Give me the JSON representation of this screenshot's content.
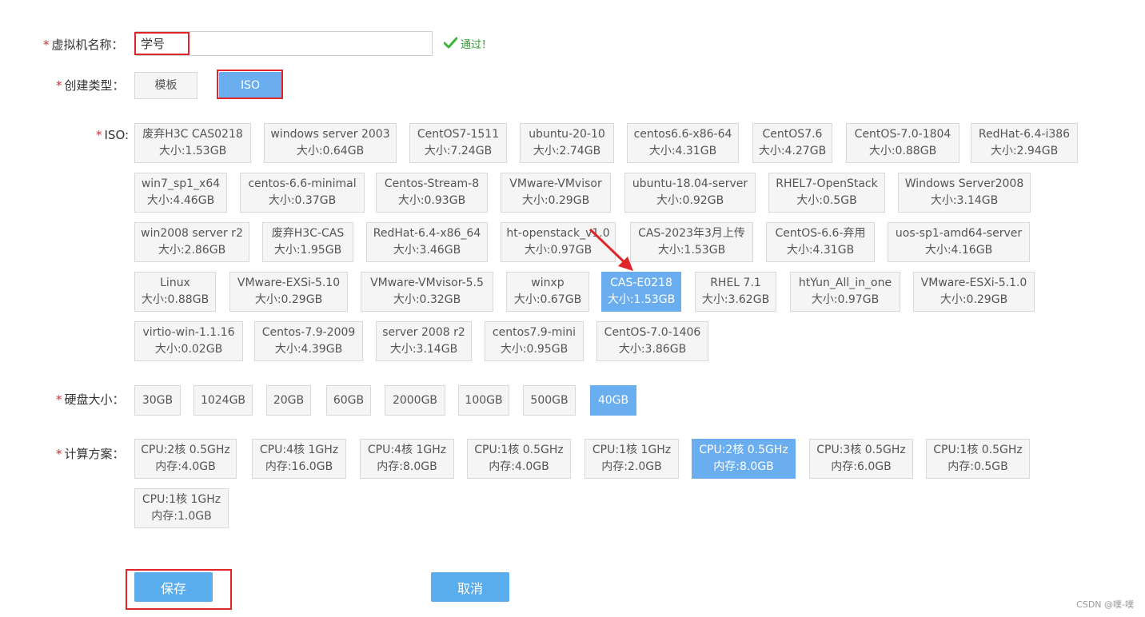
{
  "form": {
    "vm_name": {
      "label": "虚拟机名称：",
      "value": "学号",
      "status": "通过！"
    },
    "create_type": {
      "label": "创建类型：",
      "options": [
        "模板",
        "ISO"
      ],
      "selected": "ISO"
    },
    "iso": {
      "label": "ISO:",
      "items": [
        {
          "name": "废弃H3C CAS0218",
          "size": "大小:1.53GB"
        },
        {
          "name": "windows server 2003",
          "size": "大小:0.64GB"
        },
        {
          "name": "CentOS7-1511",
          "size": "大小:7.24GB"
        },
        {
          "name": "ubuntu-20-10",
          "size": "大小:2.74GB"
        },
        {
          "name": "centos6.6-x86-64",
          "size": "大小:4.31GB"
        },
        {
          "name": "CentOS7.6",
          "size": "大小:4.27GB"
        },
        {
          "name": "CentOS-7.0-1804",
          "size": "大小:0.88GB"
        },
        {
          "name": "RedHat-6.4-i386",
          "size": "大小:2.94GB"
        },
        {
          "name": "win7_sp1_x64",
          "size": "大小:4.46GB"
        },
        {
          "name": "centos-6.6-minimal",
          "size": "大小:0.37GB"
        },
        {
          "name": "Centos-Stream-8",
          "size": "大小:0.93GB"
        },
        {
          "name": "VMware-VMvisor",
          "size": "大小:0.29GB"
        },
        {
          "name": "ubuntu-18.04-server",
          "size": "大小:0.92GB"
        },
        {
          "name": "RHEL7-OpenStack",
          "size": "大小:0.5GB"
        },
        {
          "name": "Windows Server2008",
          "size": "大小:3.14GB"
        },
        {
          "name": "win2008 server r2",
          "size": "大小:2.86GB"
        },
        {
          "name": "废弃H3C-CAS",
          "size": "大小:1.95GB"
        },
        {
          "name": "RedHat-6.4-x86_64",
          "size": "大小:3.46GB"
        },
        {
          "name": "ht-openstack_v1.0",
          "size": "大小:0.97GB"
        },
        {
          "name": "CAS-2023年3月上传",
          "size": "大小:1.53GB"
        },
        {
          "name": "CentOS-6.6-弃用",
          "size": "大小:4.31GB"
        },
        {
          "name": "uos-sp1-amd64-server",
          "size": "大小:4.16GB"
        },
        {
          "name": "Linux",
          "size": "大小:0.88GB"
        },
        {
          "name": "VMware-EXSi-5.10",
          "size": "大小:0.29GB"
        },
        {
          "name": "VMware-VMvisor-5.5",
          "size": "大小:0.32GB"
        },
        {
          "name": "winxp",
          "size": "大小:0.67GB"
        },
        {
          "name": "CAS-E0218",
          "size": "大小:1.53GB"
        },
        {
          "name": "RHEL 7.1",
          "size": "大小:3.62GB"
        },
        {
          "name": "htYun_All_in_one",
          "size": "大小:0.97GB"
        },
        {
          "name": "VMware-ESXi-5.1.0",
          "size": "大小:0.29GB"
        },
        {
          "name": "virtio-win-1.1.16",
          "size": "大小:0.02GB"
        },
        {
          "name": "Centos-7.9-2009",
          "size": "大小:4.39GB"
        },
        {
          "name": "server 2008 r2",
          "size": "大小:3.14GB"
        },
        {
          "name": "centos7.9-mini",
          "size": "大小:0.95GB"
        },
        {
          "name": "CentOS-7.0-1406",
          "size": "大小:3.86GB"
        }
      ],
      "selected": "CAS-E0218"
    },
    "disk": {
      "label": "硬盘大小：",
      "options": [
        "30GB",
        "1024GB",
        "20GB",
        "60GB",
        "2000GB",
        "100GB",
        "500GB",
        "40GB"
      ],
      "selected": "40GB"
    },
    "compute": {
      "label": "计算方案：",
      "options": [
        {
          "cpu": "CPU:2核 0.5GHz",
          "mem": "内存:4.0GB"
        },
        {
          "cpu": "CPU:4核 1GHz",
          "mem": "内存:16.0GB"
        },
        {
          "cpu": "CPU:4核 1GHz",
          "mem": "内存:8.0GB"
        },
        {
          "cpu": "CPU:1核 0.5GHz",
          "mem": "内存:4.0GB"
        },
        {
          "cpu": "CPU:1核 1GHz",
          "mem": "内存:2.0GB"
        },
        {
          "cpu": "CPU:2核 0.5GHz",
          "mem": "内存:8.0GB"
        },
        {
          "cpu": "CPU:3核 0.5GHz",
          "mem": "内存:6.0GB"
        },
        {
          "cpu": "CPU:1核 0.5GHz",
          "mem": "内存:0.5GB"
        },
        {
          "cpu": "CPU:1核 1GHz",
          "mem": "内存:1.0GB"
        }
      ],
      "selected_index": 5
    },
    "buttons": {
      "save": "保存",
      "cancel": "取消"
    }
  },
  "colors": {
    "selected": "#6aaef0",
    "button": "#5aadec",
    "highlight": "#e0262a",
    "pass": "#2e9a2e"
  },
  "watermark": "CSDN @噗-噗"
}
